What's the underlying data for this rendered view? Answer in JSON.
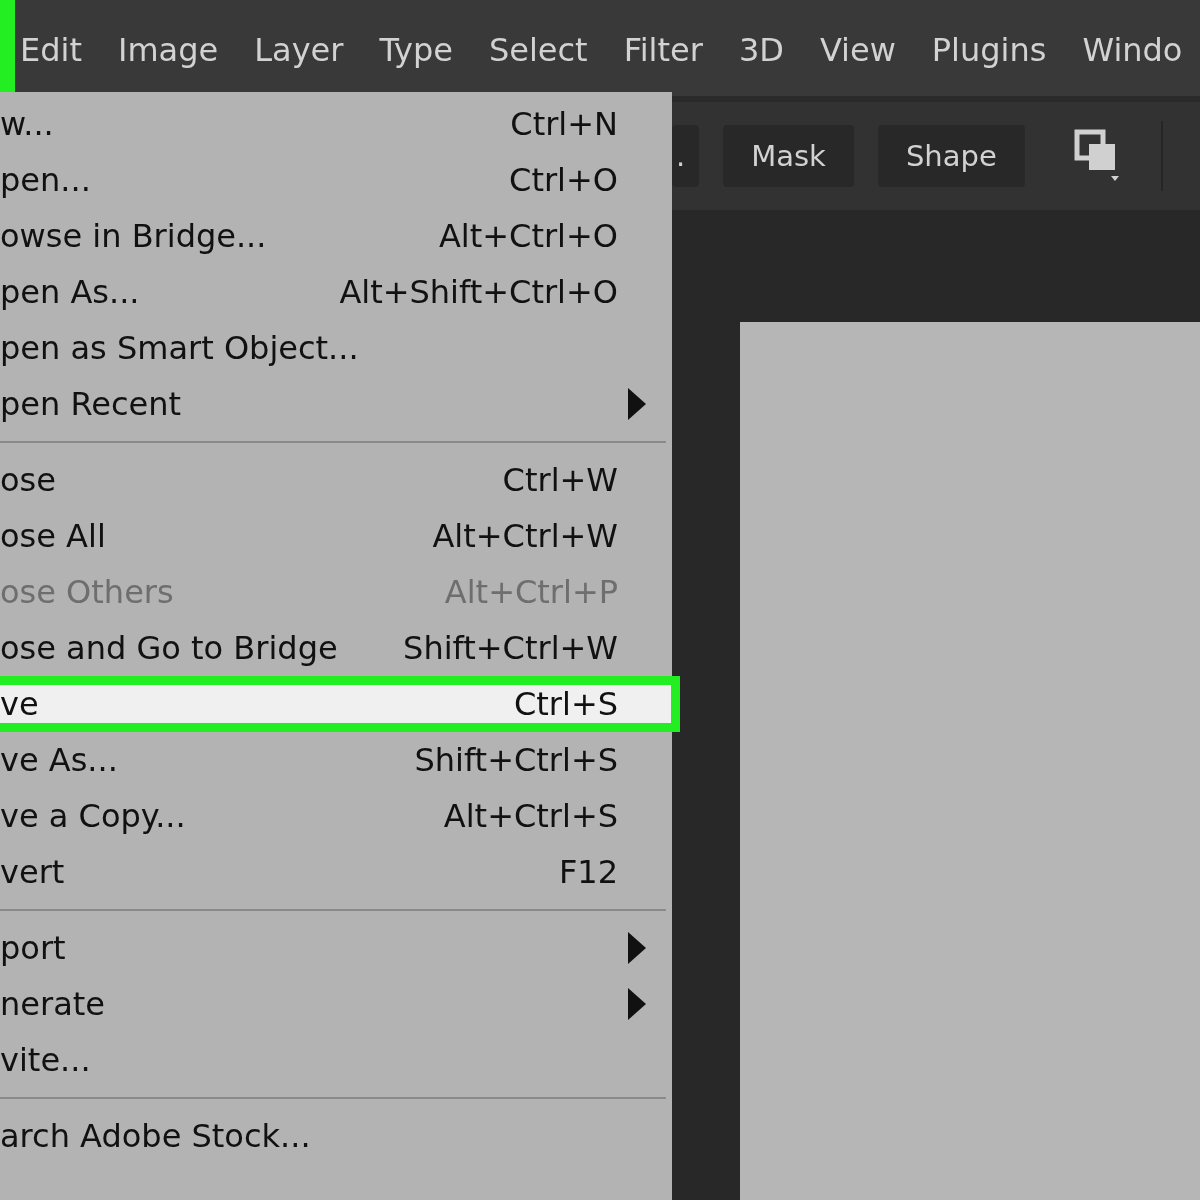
{
  "menu_bar": {
    "items": [
      {
        "label": "Edit",
        "selected": false
      },
      {
        "label": "Image",
        "selected": false
      },
      {
        "label": "Layer",
        "selected": false
      },
      {
        "label": "Type",
        "selected": false
      },
      {
        "label": "Select",
        "selected": false
      },
      {
        "label": "Filter",
        "selected": false
      },
      {
        "label": "3D",
        "selected": false
      },
      {
        "label": "View",
        "selected": false
      },
      {
        "label": "Plugins",
        "selected": false
      },
      {
        "label": "Windo",
        "selected": false
      }
    ]
  },
  "options_bar": {
    "buttons": [
      {
        "label": "."
      },
      {
        "label": "Mask"
      },
      {
        "label": "Shape"
      }
    ]
  },
  "file_menu": {
    "items": [
      {
        "kind": "item",
        "label": "w...",
        "shortcut": "Ctrl+N",
        "selected": false,
        "disabled": false
      },
      {
        "kind": "item",
        "label": "pen...",
        "shortcut": "Ctrl+O",
        "selected": false,
        "disabled": false
      },
      {
        "kind": "item",
        "label": "owse in Bridge...",
        "shortcut": "Alt+Ctrl+O",
        "selected": false,
        "disabled": false
      },
      {
        "kind": "item",
        "label": "pen As...",
        "shortcut": "Alt+Shift+Ctrl+O",
        "selected": false,
        "disabled": false
      },
      {
        "kind": "item",
        "label": "pen as Smart Object...",
        "selected": false,
        "disabled": false
      },
      {
        "kind": "submenu",
        "label": "pen Recent",
        "selected": false,
        "disabled": false
      },
      {
        "kind": "separator"
      },
      {
        "kind": "item",
        "label": "ose",
        "shortcut": "Ctrl+W",
        "selected": false,
        "disabled": false
      },
      {
        "kind": "item",
        "label": "ose All",
        "shortcut": "Alt+Ctrl+W",
        "selected": false,
        "disabled": false
      },
      {
        "kind": "item",
        "label": "ose Others",
        "shortcut": "Alt+Ctrl+P",
        "selected": false,
        "disabled": true
      },
      {
        "kind": "item",
        "label": "ose and Go to Bridge",
        "shortcut": "Shift+Ctrl+W",
        "selected": false,
        "disabled": false
      },
      {
        "kind": "item",
        "label": "ve",
        "shortcut": "Ctrl+S",
        "selected": true,
        "disabled": false
      },
      {
        "kind": "item",
        "label": "ve As...",
        "shortcut": "Shift+Ctrl+S",
        "selected": false,
        "disabled": false
      },
      {
        "kind": "item",
        "label": "ve a Copy...",
        "shortcut": "Alt+Ctrl+S",
        "selected": false,
        "disabled": false
      },
      {
        "kind": "item",
        "label": "vert",
        "shortcut": "F12",
        "selected": false,
        "disabled": false
      },
      {
        "kind": "separator"
      },
      {
        "kind": "submenu",
        "label": "port",
        "selected": false,
        "disabled": false
      },
      {
        "kind": "submenu",
        "label": "nerate",
        "selected": false,
        "disabled": false
      },
      {
        "kind": "item",
        "label": "vite...",
        "selected": false,
        "disabled": false
      },
      {
        "kind": "separator"
      },
      {
        "kind": "item",
        "label": "arch Adobe Stock...",
        "selected": false,
        "disabled": false
      }
    ]
  }
}
